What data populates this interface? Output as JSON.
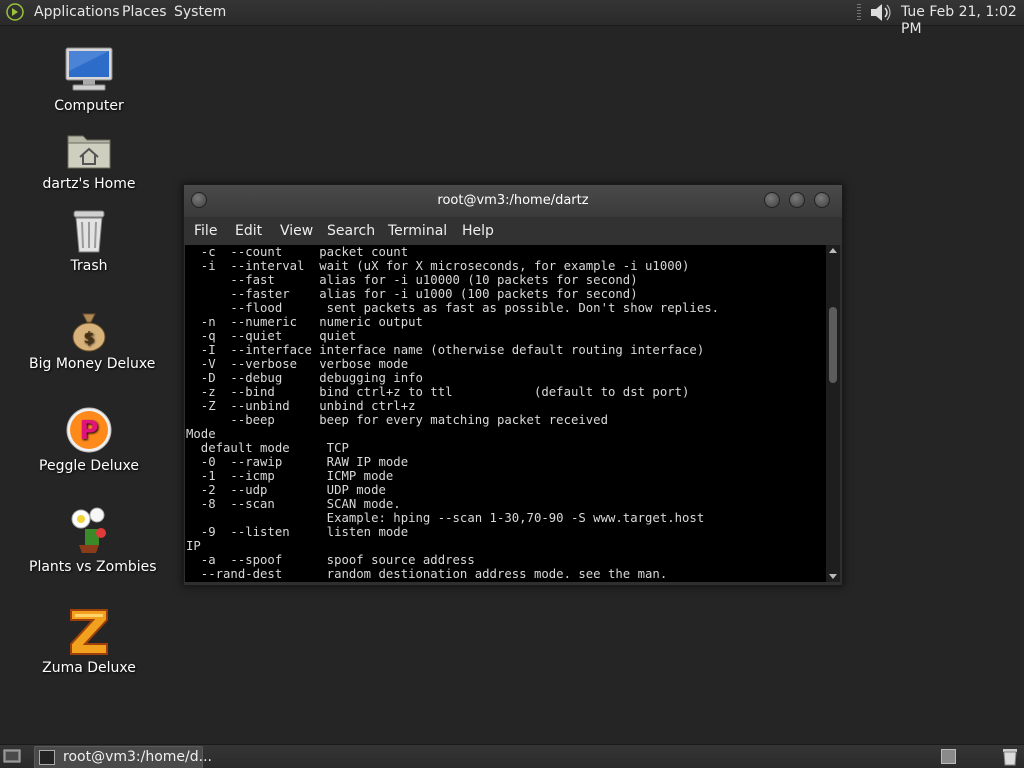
{
  "top_panel": {
    "menus": [
      "Applications",
      "Places",
      "System"
    ],
    "clock": "Tue Feb 21,  1:02 PM"
  },
  "desktop_icons": [
    {
      "label": "Computer",
      "icon": "computer-icon"
    },
    {
      "label": "dartz's Home",
      "icon": "home-folder-icon"
    },
    {
      "label": "Trash",
      "icon": "trash-icon"
    },
    {
      "label": "Big Money Deluxe",
      "icon": "money-bag-icon"
    },
    {
      "label": "Peggle Deluxe",
      "icon": "peggle-icon"
    },
    {
      "label": "Plants vs Zombies",
      "icon": "plants-vs-zombies-icon"
    },
    {
      "label": "Zuma Deluxe",
      "icon": "zuma-icon"
    }
  ],
  "terminal": {
    "title": "root@vm3:/home/dartz",
    "menu": [
      "File",
      "Edit",
      "View",
      "Search",
      "Terminal",
      "Help"
    ],
    "lines": [
      "  -c  --count     packet count",
      "  -i  --interval  wait (uX for X microseconds, for example -i u1000)",
      "      --fast      alias for -i u10000 (10 packets for second)",
      "      --faster    alias for -i u1000 (100 packets for second)",
      "      --flood      sent packets as fast as possible. Don't show replies.",
      "  -n  --numeric   numeric output",
      "  -q  --quiet     quiet",
      "  -I  --interface interface name (otherwise default routing interface)",
      "  -V  --verbose   verbose mode",
      "  -D  --debug     debugging info",
      "  -z  --bind      bind ctrl+z to ttl           (default to dst port)",
      "  -Z  --unbind    unbind ctrl+z",
      "      --beep      beep for every matching packet received",
      "Mode",
      "  default mode     TCP",
      "  -0  --rawip      RAW IP mode",
      "  -1  --icmp       ICMP mode",
      "  -2  --udp        UDP mode",
      "  -8  --scan       SCAN mode.",
      "                   Example: hping --scan 1-30,70-90 -S www.target.host",
      "  -9  --listen     listen mode",
      "IP",
      "  -a  --spoof      spoof source address",
      "  --rand-dest      random destionation address mode. see the man."
    ]
  },
  "taskbar": {
    "tasks": [
      {
        "label": "root@vm3:/home/d...",
        "icon": "terminal-icon"
      }
    ]
  },
  "colors": {
    "desktop_bg": "#252525",
    "panel_bg": "#2f2f2f",
    "terminal_bg": "#000000",
    "terminal_fg": "#d9d9d9"
  }
}
